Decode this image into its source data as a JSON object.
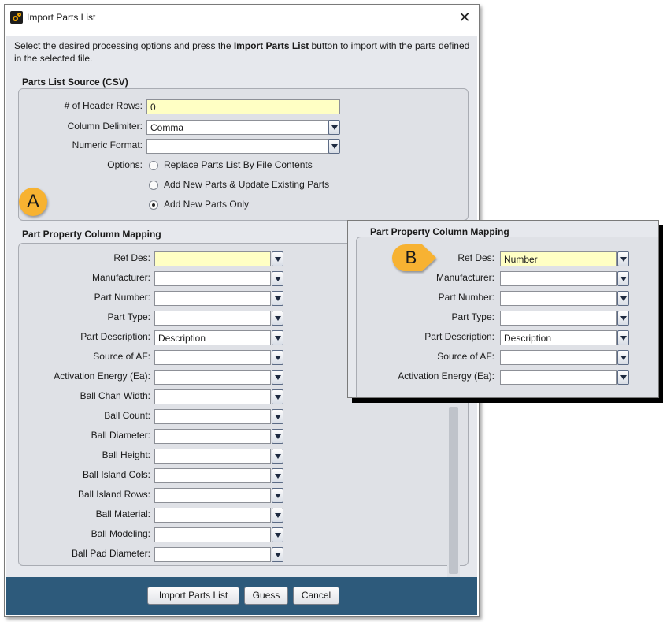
{
  "window": {
    "title": "Import Parts List",
    "close_glyph": "✕",
    "intro_before": "Select the desired processing options and press the ",
    "intro_bold": "Import Parts List",
    "intro_after": " button to import with the parts defined in the selected file."
  },
  "source": {
    "title": "Parts List Source (CSV)",
    "header_rows_label": "# of Header Rows:",
    "header_rows_value": "0",
    "delimiter_label": "Column Delimiter:",
    "delimiter_value": "Comma",
    "numeric_format_label": "Numeric Format:",
    "numeric_format_value": "",
    "options_label": "Options:",
    "options": [
      {
        "label": "Replace Parts List By File Contents",
        "selected": false
      },
      {
        "label": "Add New Parts & Update Existing Parts",
        "selected": false
      },
      {
        "label": "Add New Parts Only",
        "selected": true
      }
    ]
  },
  "mapping": {
    "title": "Part Property Column Mapping",
    "rows": [
      {
        "label": "Ref Des:",
        "value": ""
      },
      {
        "label": "Manufacturer:",
        "value": ""
      },
      {
        "label": "Part Number:",
        "value": ""
      },
      {
        "label": "Part Type:",
        "value": ""
      },
      {
        "label": "Part Description:",
        "value": "Description"
      },
      {
        "label": "Source of AF:",
        "value": ""
      },
      {
        "label": "Activation Energy (Ea):",
        "value": ""
      },
      {
        "label": "Ball Chan Width:",
        "value": ""
      },
      {
        "label": "Ball Count:",
        "value": ""
      },
      {
        "label": "Ball Diameter:",
        "value": ""
      },
      {
        "label": "Ball Height:",
        "value": ""
      },
      {
        "label": "Ball Island Cols:",
        "value": ""
      },
      {
        "label": "Ball Island Rows:",
        "value": ""
      },
      {
        "label": "Ball Material:",
        "value": ""
      },
      {
        "label": "Ball Modeling:",
        "value": ""
      },
      {
        "label": "Ball Pad Diameter:",
        "value": ""
      }
    ]
  },
  "inset": {
    "title": "Part Property Column Mapping",
    "rows": [
      {
        "label": "Ref Des:",
        "value": "Number"
      },
      {
        "label": "Manufacturer:",
        "value": ""
      },
      {
        "label": "Part Number:",
        "value": ""
      },
      {
        "label": "Part Type:",
        "value": ""
      },
      {
        "label": "Part Description:",
        "value": "Description"
      },
      {
        "label": "Source of AF:",
        "value": ""
      },
      {
        "label": "Activation Energy (Ea):",
        "value": ""
      }
    ]
  },
  "footer": {
    "import_label": "Import Parts List",
    "guess_label": "Guess",
    "cancel_label": "Cancel"
  },
  "callouts": {
    "a": "A",
    "b": "B"
  },
  "colors": {
    "footer": "#2d5a7b",
    "highlight_field": "#ffffc4",
    "callout": "#f7b231"
  }
}
